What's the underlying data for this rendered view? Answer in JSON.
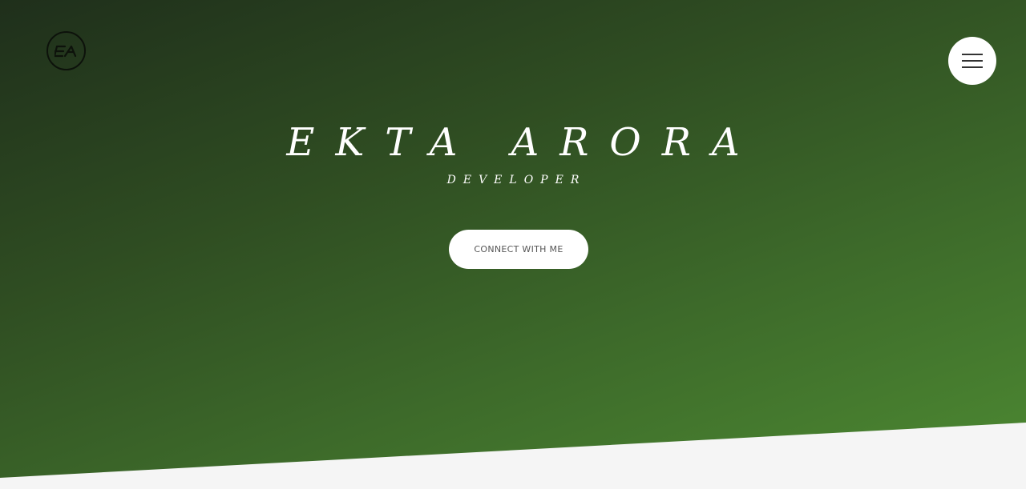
{
  "header": {
    "logo_icon": "ea-monogram-logo",
    "menu_icon": "hamburger-menu-icon"
  },
  "hero": {
    "name": "EKTA ARORA",
    "role": "DEVELOPER",
    "cta_label": "Connect with me"
  },
  "colors": {
    "gradient_dark": "#1f2f1b",
    "gradient_mid": "#2f4d22",
    "gradient_light": "#4d8a32",
    "text": "#ffffff",
    "button_bg": "#ffffff",
    "page_bg": "#f6f6f6"
  }
}
